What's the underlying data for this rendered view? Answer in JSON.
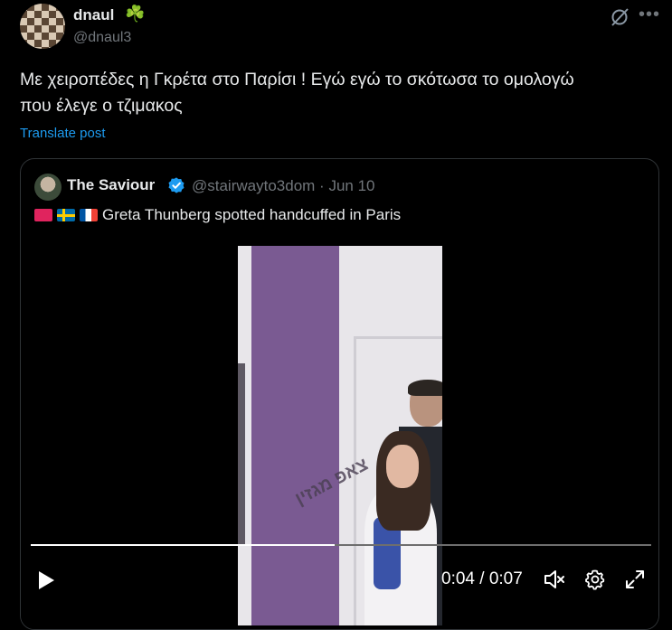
{
  "post": {
    "display_name": "dnaul",
    "name_emoji": "☘️",
    "handle": "@dnaul3",
    "text_line1": "Με χειροπέδες η Γκρέτα στο Παρίσι ! Εγώ εγώ το σκότωσα το ομολογώ",
    "text_line2": "που έλεγε ο τζιμακος",
    "translate_label": "Translate post",
    "icons": [
      "grok-icon",
      "more-icon"
    ]
  },
  "quote": {
    "display_name": "The Saviour",
    "verified": true,
    "handle": "@stairwayto3dom",
    "separator": "·",
    "date": "Jun 10",
    "emojis": [
      "siren",
      "flag-sweden",
      "flag-france"
    ],
    "text": "Greta Thunberg spotted handcuffed in Paris"
  },
  "video": {
    "watermark": "צאפ מגזין",
    "progress_fraction": 0.49,
    "time_display": "0:04 / 0:07",
    "controls": [
      "play-icon",
      "mute-icon",
      "settings-icon",
      "fullscreen-icon"
    ]
  },
  "colors": {
    "background": "#000000",
    "text_primary": "#e7e9ea",
    "text_secondary": "#71767b",
    "link": "#1d9bf0",
    "border": "#2f3336",
    "clover": "#2fb344"
  }
}
